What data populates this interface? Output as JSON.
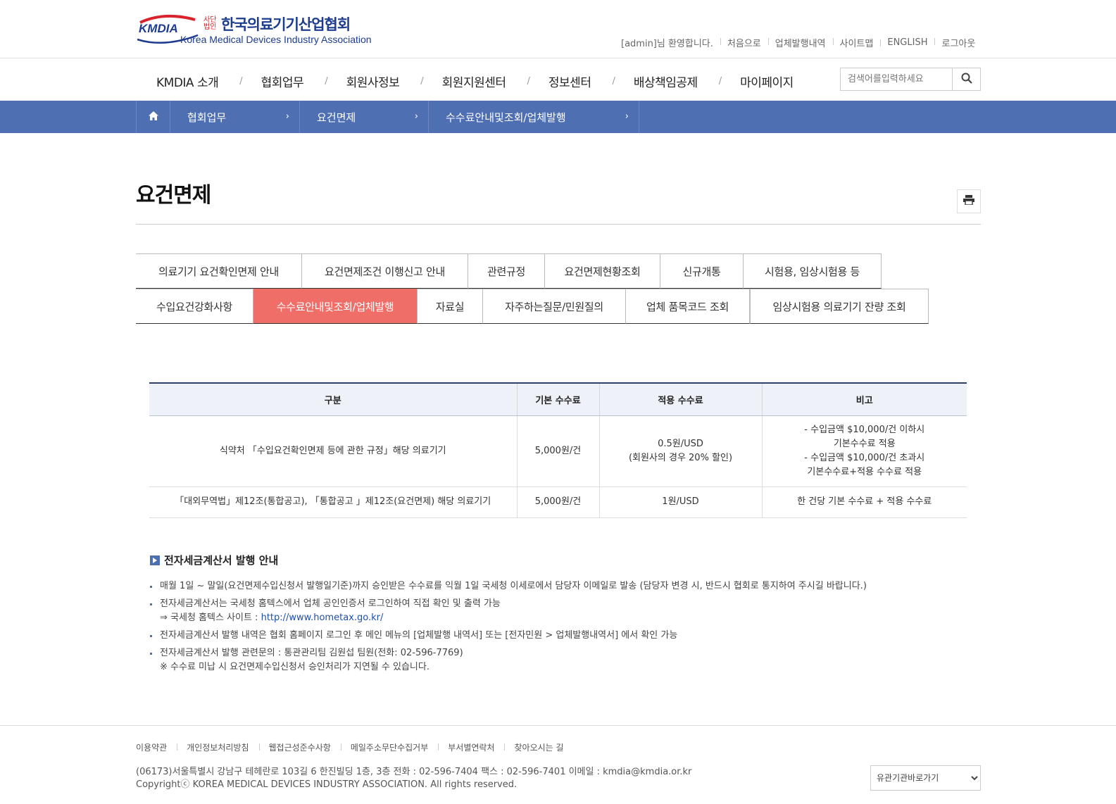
{
  "header": {
    "logo": {
      "mark_text": "KMDIA",
      "corp_type": "사단법인",
      "kr_name": "한국의료기기산업협회",
      "en_name": "Korea Medical Devices Industry Association"
    },
    "util_links": [
      "[admin]님 환영합니다.",
      "처음으로",
      "업체발행내역",
      "사이트맵",
      "ENGLISH",
      "로그아웃"
    ],
    "gnb": [
      "KMDIA 소개",
      "협회업무",
      "회원사정보",
      "회원지원센터",
      "정보센터",
      "배상책임공제",
      "마이페이지"
    ],
    "gnb_separator": "/",
    "search": {
      "placeholder": "검색어를입력하세요"
    }
  },
  "breadcrumb": [
    "협회업무",
    "요건면제",
    "수수료안내및조회/업체발행"
  ],
  "page_title": "요건면제",
  "tabs": {
    "row1": [
      "의료기기 요건확인면제 안내",
      "요건면제조건 이행신고 안내",
      "관련규정",
      "요건면제현황조회",
      "신규개통",
      "시험용, 임상시험용 등"
    ],
    "row2": [
      "수입요건강화사항",
      "수수료안내및조회/업체발행",
      "자료실",
      "자주하는질문/민원질의",
      "업체 품목코드 조회",
      "임상시험용 의료기기 잔량 조회"
    ],
    "active": "수수료안내및조회/업체발행"
  },
  "fee_table": {
    "headers": [
      "구분",
      "기본 수수료",
      "적용 수수료",
      "비고"
    ],
    "rows": [
      {
        "category": "식약처 「수입요건확인면제 등에 관한 규정」해당 의료기기",
        "base_fee": "5,000원/건",
        "applied_fee_1": "0.5원/USD",
        "applied_fee_2": "(회원사의 경우 20% 할인)",
        "note_1": "- 수입금액 $10,000/건 이하시",
        "note_2": "기본수수료 적용",
        "note_3": "- 수입금액 $10,000/건 초과시",
        "note_4": "기본수수료+적용 수수료 적용"
      },
      {
        "category": "「대외무역법」제12조(통합공고), 「통합공고 」제12조(요건면제) 해당 의료기기",
        "base_fee": "5,000원/건",
        "applied_fee": "1원/USD",
        "note": "한 건당 기본 수수료 + 적용 수수료"
      }
    ]
  },
  "notice": {
    "title": "전자세금계산서 발행 안내",
    "items": {
      "item1": "매월 1일 ~ 말일(요건면제수입신청서 발행일기준)까지 승인받은 수수료를 익월 1일 국세청 이세로에서 담당자 이메일로 발송 (담당자 변경 시, 반드시 협회로 통지하여 주시길 바랍니다.)",
      "item2_line1": "전자세금계산서는 국세청 홈텍스에서 업체 공인인증서 로그인하여 직접 확인 및 출력 가능",
      "item2_line2_prefix": "⇒ 국세청 홈텍스 사이트 : ",
      "item2_link": "http://www.hometax.go.kr/",
      "item3": "전자세금계산서 발행 내역은 협회 홈페이지 로그인 후 메인 메뉴의 [업체발행 내역서] 또는 [전자민원 > 업체발행내역서] 에서 확인 가능",
      "item4_line1": "전자세금계산서 발행 관련문의 : 통관관리팀 김원섭 팀원(전화: 02-596-7769)",
      "item4_line2": "※ 수수료 미납 시 요건면제수입신청서 승인처리가 지연될 수 있습니다."
    }
  },
  "footer": {
    "links": [
      "이용약관",
      "개인정보처리방침",
      "웹접근성준수사항",
      "메일주소무단수집거부",
      "부서별연락처",
      "찾아오시는 길"
    ],
    "address": "(06173)서울특별시 강남구 테헤란로 103길 6 한진빌딩 1층, 3층 전화 : 02-596-7404 팩스 : 02-596-7401 이메일 : kmdia@kmdia.or.kr",
    "copyright": "Copyrightⓒ KOREA MEDICAL DEVICES INDUSTRY ASSOCIATION. All rights reserved.",
    "family_site": "유관기관바로가기"
  },
  "colors": {
    "brand_blue": "#1d3c8f",
    "crumb_bar": "#4f6fb3",
    "active_tab": "#ef6f68",
    "logo_red": "#d9232d"
  },
  "icons": {
    "home": "home-icon",
    "search": "search-icon",
    "print": "printer-icon",
    "crumb_arrow": "chevron-right-icon",
    "notice": "square-arrow-icon"
  }
}
